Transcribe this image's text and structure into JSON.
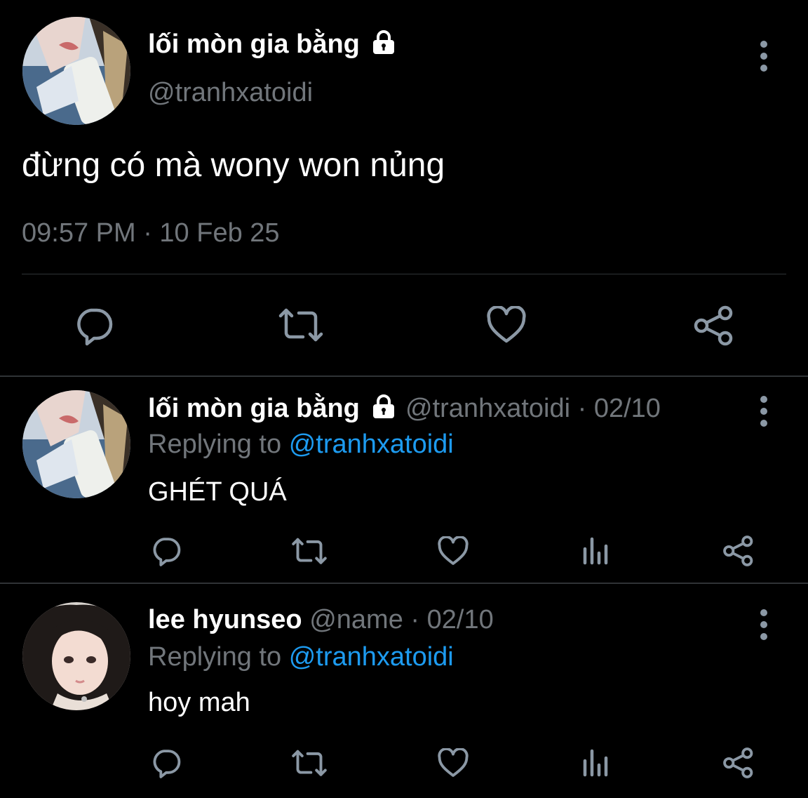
{
  "main_tweet": {
    "display_name": "lối mòn gia bằng",
    "handle": "@tranhxatoidi",
    "text": "đừng có mà wony won nủng",
    "timestamp": "09:57 PM · 10 Feb 25",
    "locked": true,
    "avatar": "avatar-photo-woman-sweater",
    "actions": [
      "reply-icon",
      "retweet-icon",
      "like-icon",
      "share-icon"
    ]
  },
  "replies": [
    {
      "display_name": "lối mòn gia bằng",
      "locked": true,
      "handle": "@tranhxatoidi",
      "date": "· 02/10",
      "replying_label": "Replying to",
      "replying_handle": "@tranhxatoidi",
      "text": "GHÉT QUÁ",
      "avatar": "avatar-photo-woman-sweater"
    },
    {
      "display_name": "lee hyunseo",
      "locked": false,
      "handle": "@name",
      "date": "· 02/10",
      "replying_label": "Replying to",
      "replying_handle": "@tranhxatoidi",
      "text": "hoy mah",
      "avatar": "avatar-photo-girl-long-hair"
    }
  ],
  "colors": {
    "background": "#000000",
    "text": "#e7e9ea",
    "muted": "#71767b",
    "link": "#1d9bf0",
    "divider": "#2f3336",
    "icon": "#8b98a5"
  }
}
